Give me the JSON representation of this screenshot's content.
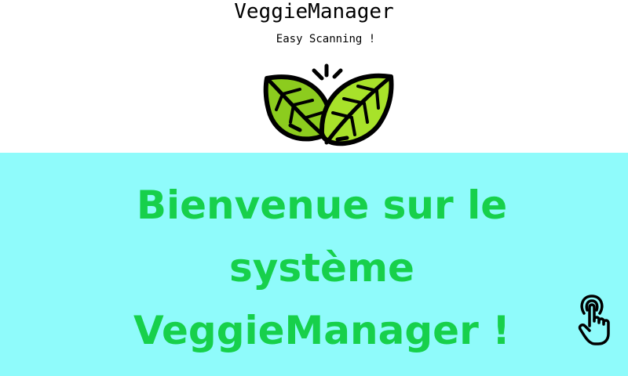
{
  "header": {
    "title": "VeggieManager",
    "subtitle": "Easy Scanning !",
    "logo_icon": "leaves-icon"
  },
  "welcome": {
    "message": "Bienvenue sur le système VeggieManager !",
    "color": "#17d04b"
  },
  "touch_button": {
    "icon": "touch-hand-icon"
  },
  "colors": {
    "header_background": "#ffffff",
    "panel_background": "#8ffbfb",
    "leaf_light": "#a8e22a",
    "leaf_dark": "#6cb61a",
    "outline": "#000000"
  }
}
